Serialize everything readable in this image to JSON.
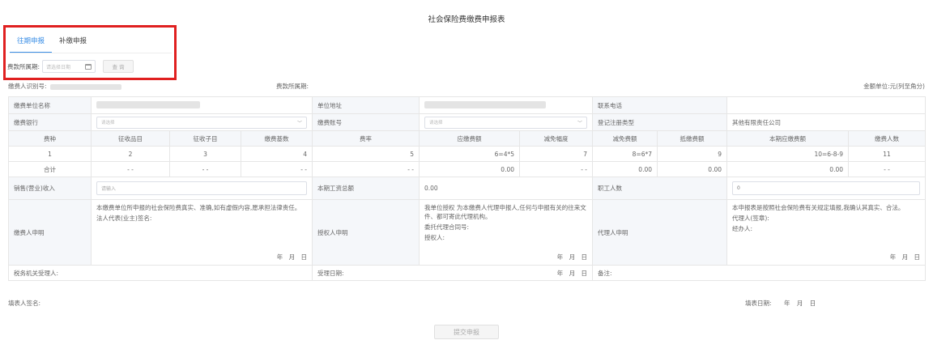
{
  "header": {
    "title": "社会保险费缴费申报表"
  },
  "tabs": [
    {
      "label": "往期申报"
    },
    {
      "label": "补缴申报"
    }
  ],
  "period": {
    "label": "费款所属期:",
    "placeholder": "请选择日期",
    "query_label": "查 询"
  },
  "info": {
    "payer_id_label": "缴费人识别号:",
    "period_label": "费款所属期:",
    "unit_label": "金额单位:元(列至角分)"
  },
  "labels": {
    "unit_name": "缴费单位名称",
    "unit_address": "单位地址",
    "phone": "联系电话",
    "bank": "缴费银行",
    "account": "缴费账号",
    "reg_type": "登记注册类型",
    "reg_type_value": "其他有限责任公司",
    "select_placeholder": "请选择"
  },
  "fee_table": {
    "headers": [
      "费种",
      "征收品目",
      "征收子目",
      "缴费基数",
      "费率",
      "应缴费额",
      "减免幅度",
      "减免费额",
      "抵缴费额",
      "本期应缴费额",
      "缴费人数"
    ],
    "index_row": [
      "1",
      "2",
      "3",
      "4",
      "5",
      "6=4*5",
      "7",
      "8=6*7",
      "9",
      "10=6-8-9",
      "11"
    ],
    "total_row": [
      "合计",
      "- -",
      "- -",
      "- -",
      "- -",
      "0.00",
      "- -",
      "0.00",
      "0.00",
      "0.00",
      "- -"
    ]
  },
  "income": {
    "sales_label": "销售(营业)收入",
    "sales_placeholder": "请输入",
    "wage_label": "本期工资总额",
    "wage_value": "0.00",
    "staff_label": "职工人数",
    "staff_value": "0"
  },
  "declarations": {
    "payer_label": "缴费人申明",
    "payer_text": "本缴费单位所申报的社会保险费真实、准确,如有虚假内容,愿承担法律责任。",
    "payer_sign": "法人代表(业主)签名:",
    "auth_label": "授权人申明",
    "auth_text": "我单位授权 为本缴费人代理申报人,任何与申报有关的往来文件、都可寄此代理机构。",
    "auth_contract": "委托代理合同号:",
    "auth_person": "授权人:",
    "agent_label": "代理人申明",
    "agent_text": "本申报表是按照社会保险费有关规定填报,我确认其真实、合法。",
    "agent_sign": "代理人(签章):",
    "agent_handler": "经办人:",
    "date": "年 月 日"
  },
  "accept": {
    "tax_officer": "税务机关受理人:",
    "accept_date": "受理日期:",
    "date": "年 月 日",
    "remark": "备注:"
  },
  "footer": {
    "filler_sign": "填表人签名:",
    "fill_date_label": "填表日期:",
    "fill_date": "年 月 日",
    "submit_label": "提交申报"
  }
}
